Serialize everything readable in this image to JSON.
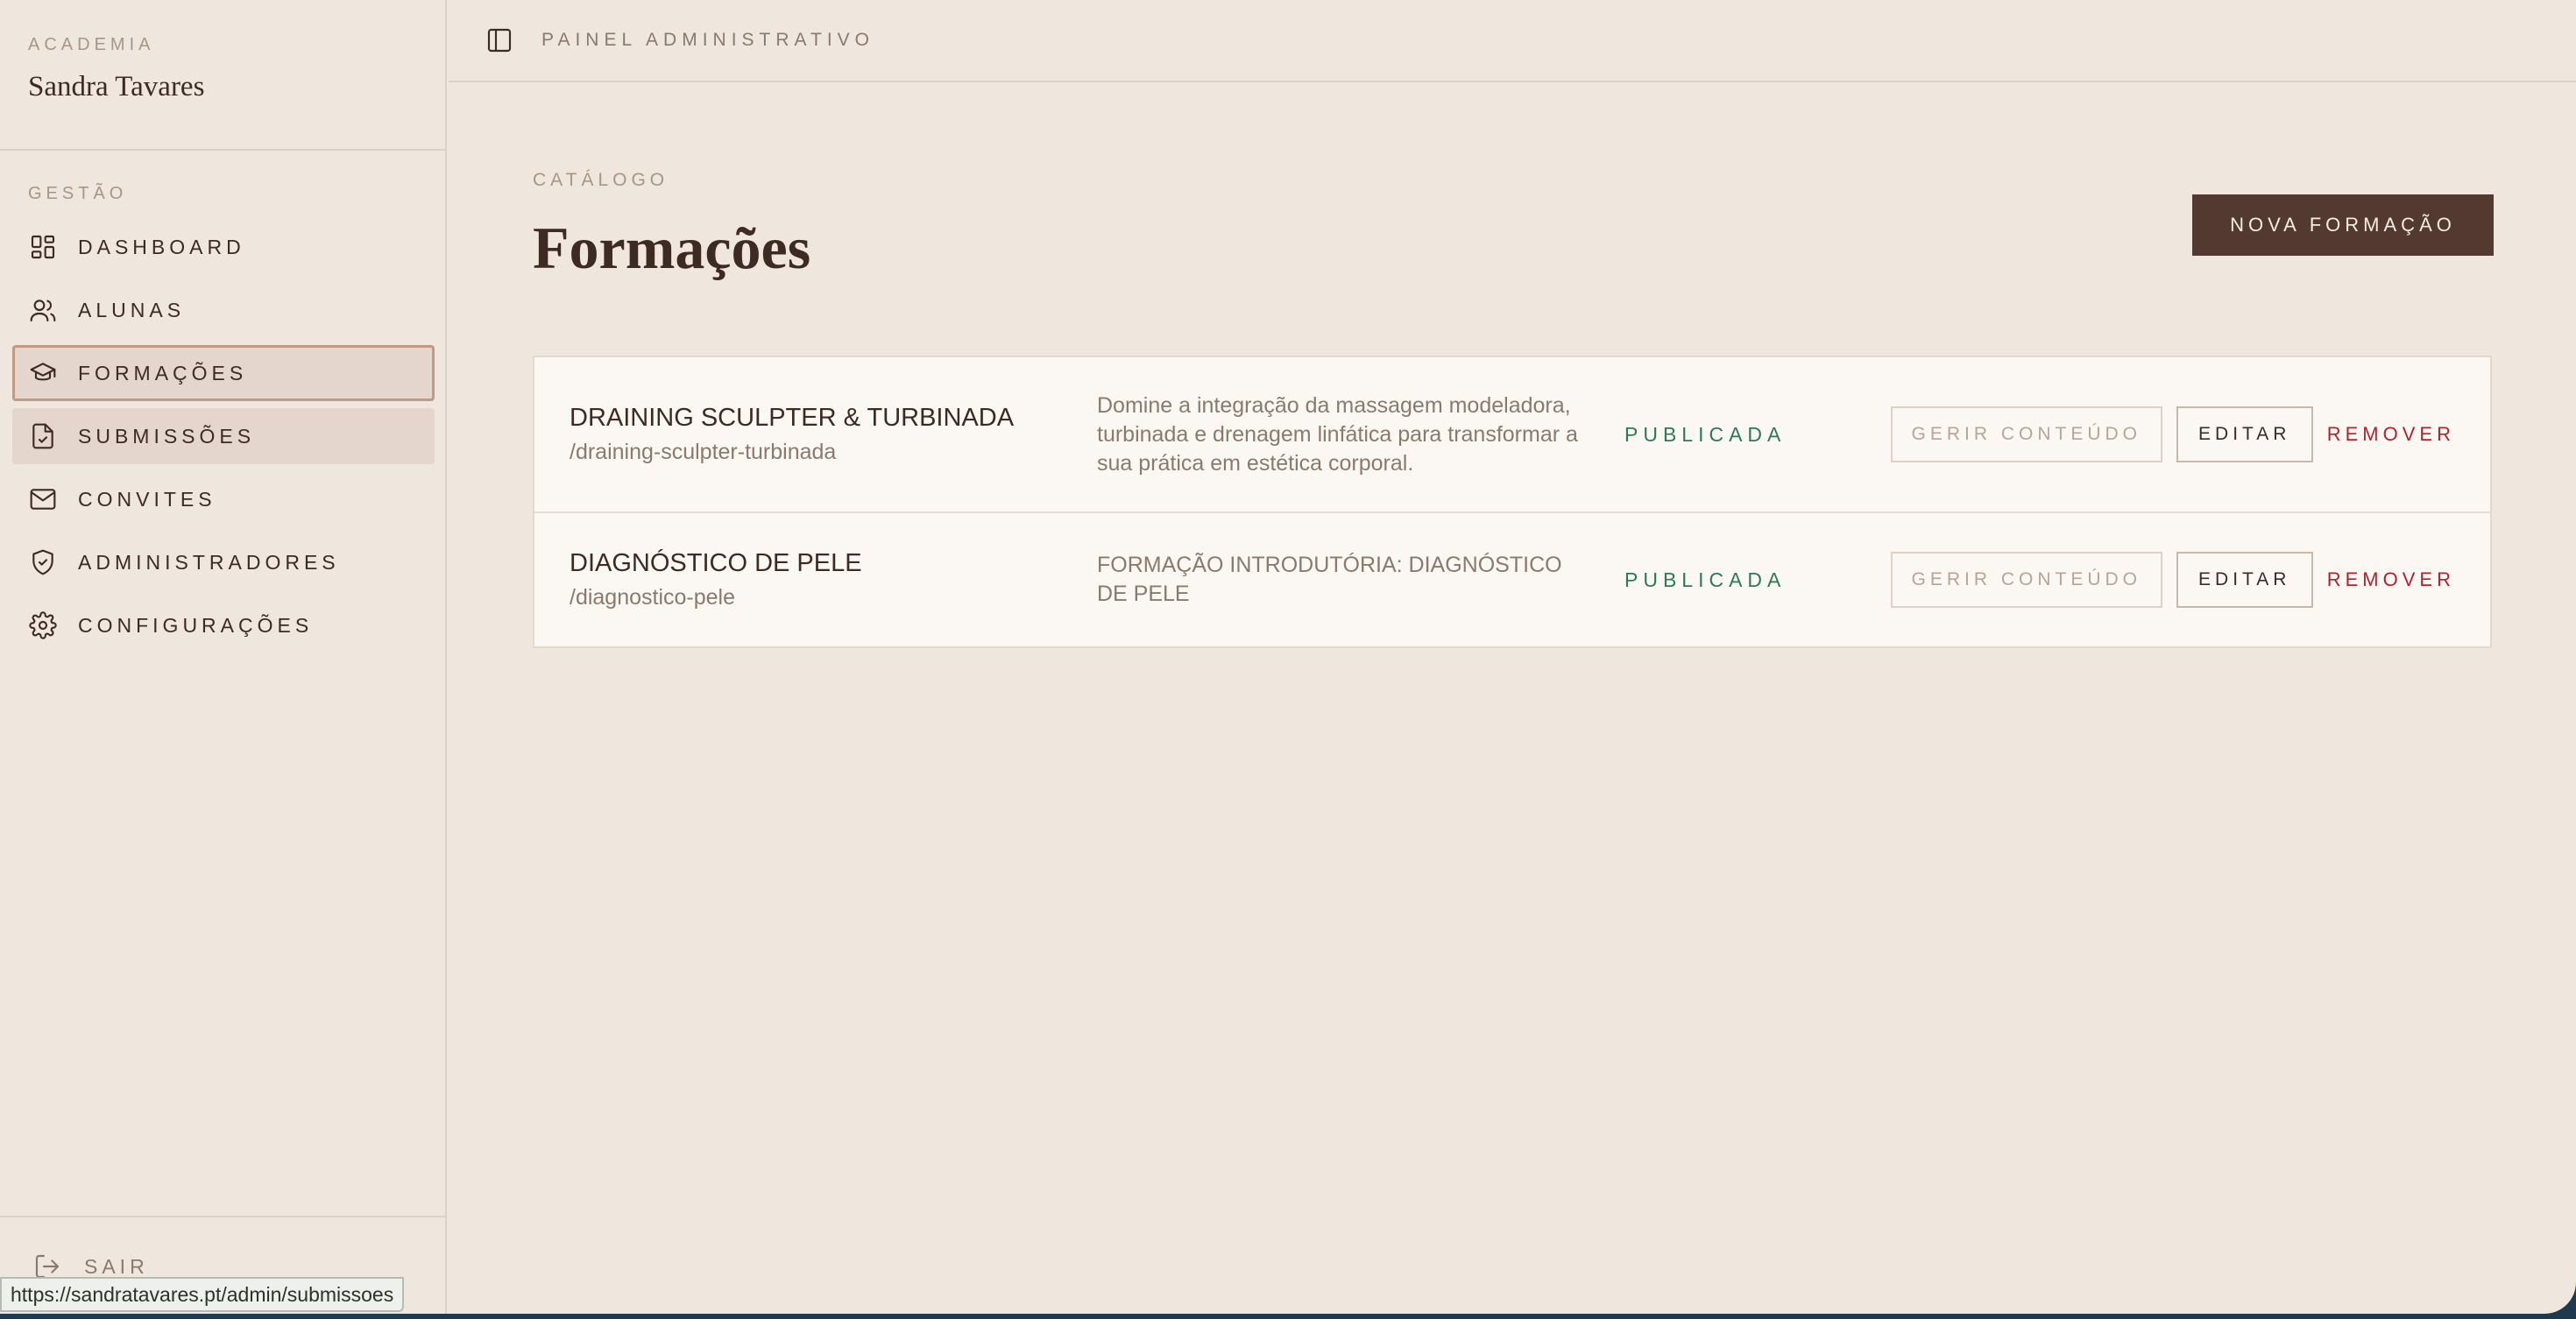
{
  "brand": {
    "kicker": "ACADEMIA",
    "name": "Sandra Tavares"
  },
  "nav": {
    "heading": "GESTÃO",
    "items": [
      {
        "label": "DASHBOARD",
        "icon": "dashboard-icon"
      },
      {
        "label": "ALUNAS",
        "icon": "users-icon"
      },
      {
        "label": "FORMAÇÕES",
        "icon": "graduation-cap-icon",
        "state": "active"
      },
      {
        "label": "SUBMISSÕES",
        "icon": "file-check-icon",
        "state": "hover"
      },
      {
        "label": "CONVITES",
        "icon": "mail-icon"
      },
      {
        "label": "ADMINISTRADORES",
        "icon": "shield-check-icon"
      },
      {
        "label": "CONFIGURAÇÕES",
        "icon": "gear-icon"
      }
    ],
    "logout": "SAIR"
  },
  "topbar": {
    "title": "PAINEL ADMINISTRATIVO",
    "toggle_icon": "sidebar-toggle-icon"
  },
  "main": {
    "kicker": "CATÁLOGO",
    "title": "Formações",
    "new_button": "NOVA FORMAÇÃO"
  },
  "courses": [
    {
      "name": "DRAINING SCULPTER & TURBINADA",
      "slug": "/draining-sculpter-turbinada",
      "description": "Domine a integração da massagem modeladora, turbinada e drenagem linfática para transformar a sua prática em estética corporal.",
      "status": "PUBLICADA",
      "manage_label": "GERIR CONTEÚDO",
      "edit_label": "EDITAR",
      "remove_label": "REMOVER"
    },
    {
      "name": "DIAGNÓSTICO DE PELE",
      "slug": "/diagnostico-pele",
      "description": "FORMAÇÃO INTRODUTÓRIA: DIAGNÓSTICO DE PELE",
      "status": "PUBLICADA",
      "manage_label": "GERIR CONTEÚDO",
      "edit_label": "EDITAR",
      "remove_label": "REMOVER"
    }
  ],
  "status_url": "https://sandratavares.pt/admin/submissoes",
  "colors": {
    "background": "#efe6dd",
    "primary": "#53392f",
    "published": "#2e7a52",
    "danger": "#b0232c",
    "active_nav": "#e4d6cc"
  }
}
